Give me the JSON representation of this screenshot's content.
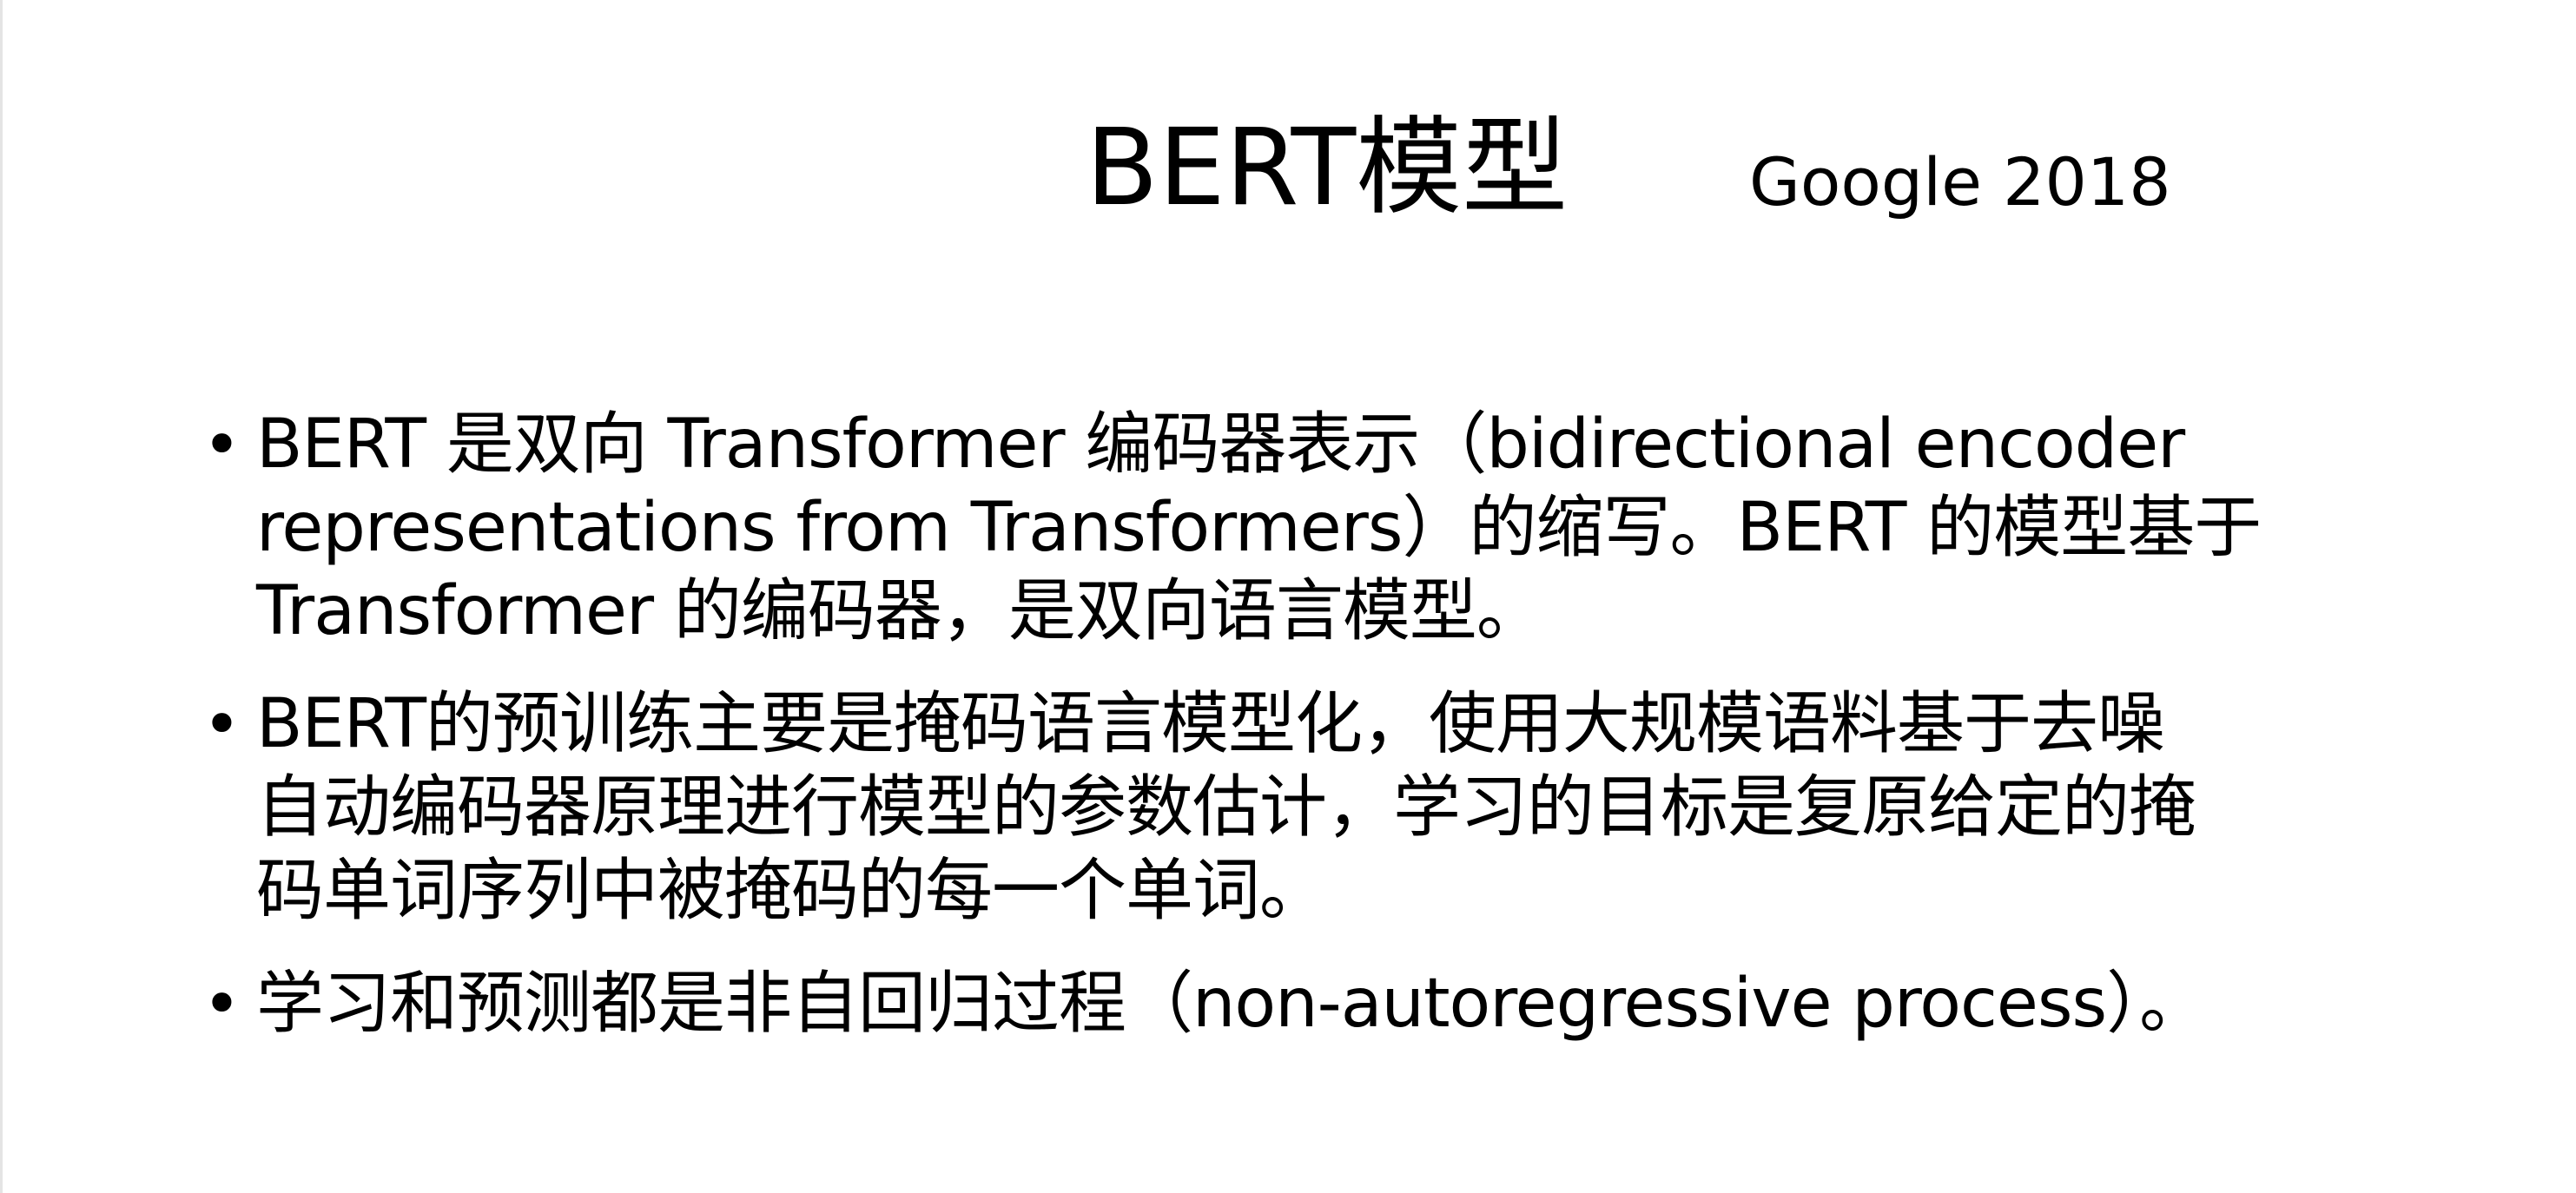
{
  "title": "BERT模型",
  "subtitle": "Google  2018",
  "bullet_marker": "•",
  "bullets": [
    {
      "lines": [
        "BERT 是双向 Transformer 编码器表示（bidirectional encoder",
        "representations from Transformers）的缩写。BERT 的模型基于",
        "Transformer 的编码器，是双向语言模型。"
      ]
    },
    {
      "lines": [
        "BERT的预训练主要是掩码语言模型化，使用大规模语料基于去噪",
        "自动编码器原理进行模型的参数估计，学习的目标是复原给定的掩",
        "码单词序列中被掩码的每一个单词。"
      ]
    },
    {
      "lines": [
        "学习和预测都是非自回归过程（non-autoregressive process）。"
      ]
    }
  ]
}
